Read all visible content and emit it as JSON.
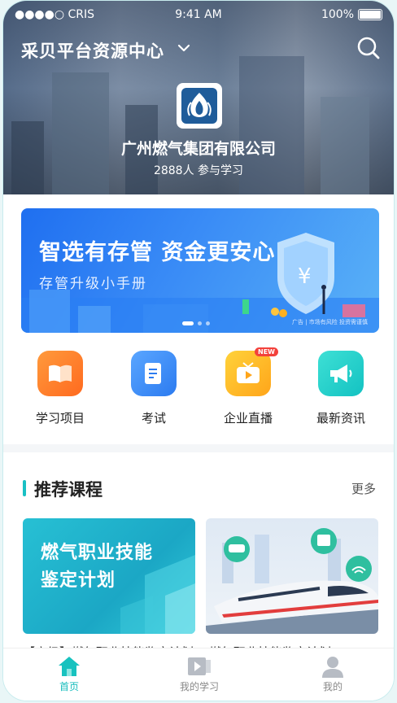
{
  "status_bar": {
    "carrier": "●●●●○ CRIS",
    "time": "9:41 AM",
    "battery": "100%"
  },
  "header": {
    "title": "采贝平台资源中心"
  },
  "company": {
    "name": "广州燃气集团有限公司",
    "learners": "2888人 参与学习"
  },
  "banner": {
    "title": "智选有存管 资金更安心",
    "subtitle": "存管升级小手册",
    "note": "广告 | 市场有风险 投资需谨慎",
    "active_slide": 1,
    "slide_count": 3
  },
  "categories": [
    {
      "label": "学习项目",
      "icon": "book-icon",
      "color": "#ff7a2d"
    },
    {
      "label": "考试",
      "icon": "document-icon",
      "color": "#3b8ef5"
    },
    {
      "label": "企业直播",
      "icon": "tv-icon",
      "color": "#ffb51f",
      "badge": "NEW"
    },
    {
      "label": "最新资讯",
      "icon": "megaphone-icon",
      "color": "#1fd0c9"
    }
  ],
  "section": {
    "title": "推荐课程",
    "more": "更多"
  },
  "courses": [
    {
      "cover_title": "燃气职业技能鉴定计划",
      "caption": "【高级】燃气职业技能鉴定计划"
    },
    {
      "caption": "燃气职业技能鉴定计划"
    }
  ],
  "tabs": [
    {
      "label": "首页",
      "icon": "home-icon",
      "active": true
    },
    {
      "label": "我的学习",
      "icon": "play-book-icon",
      "active": false
    },
    {
      "label": "我的",
      "icon": "user-icon",
      "active": false
    }
  ],
  "colors": {
    "accent": "#17bdbd",
    "banner": "#1f6ff0"
  }
}
